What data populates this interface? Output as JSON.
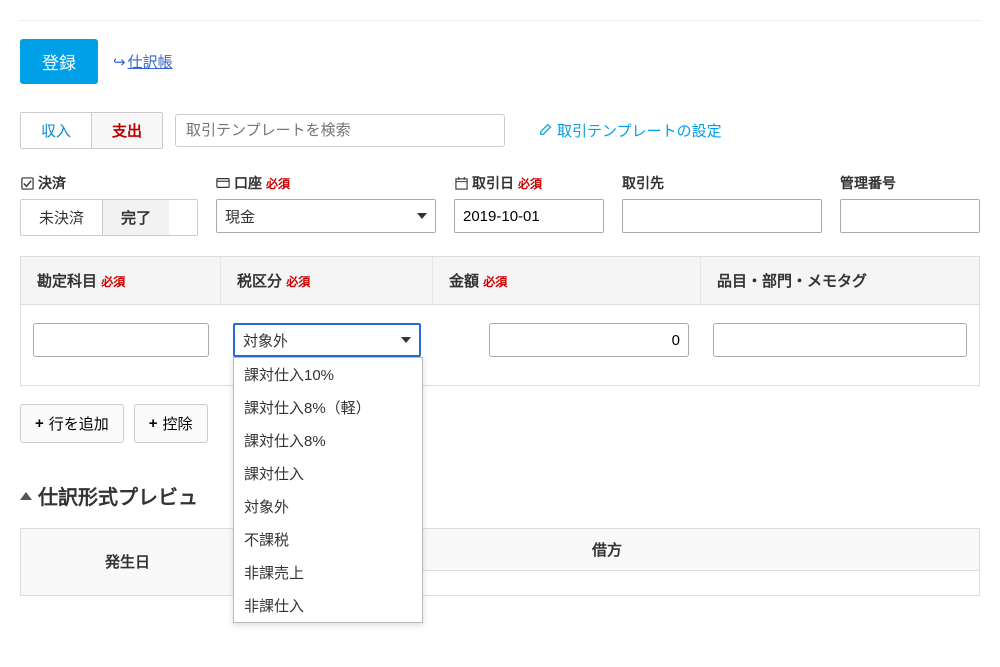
{
  "top": {
    "register_label": "登録",
    "journal_link": "仕訳帳"
  },
  "type_toggle": {
    "income": "収入",
    "expense": "支出"
  },
  "search": {
    "placeholder": "取引テンプレートを検索"
  },
  "template_settings_link": "取引テンプレートの設定",
  "fields": {
    "settlement": {
      "label": "決済",
      "pending": "未決済",
      "done": "完了"
    },
    "account": {
      "label": "口座",
      "value": "現金"
    },
    "date": {
      "label": "取引日",
      "value": "2019-10-01"
    },
    "partner": {
      "label": "取引先"
    },
    "mgmt_no": {
      "label": "管理番号"
    }
  },
  "required_label": "必須",
  "columns": {
    "account": "勘定科目",
    "tax": "税区分",
    "amount": "金額",
    "item": "品目・部門・メモタグ"
  },
  "row": {
    "tax_value": "対象外",
    "amount_value": "0"
  },
  "tax_options": [
    "課対仕入10%",
    "課対仕入8%（軽）",
    "課対仕入8%",
    "課対仕入",
    "対象外",
    "不課税",
    "非課売上",
    "非課仕入"
  ],
  "actions": {
    "add_row": "行を追加",
    "deduction": "控除"
  },
  "preview": {
    "title": "仕訳形式プレビュ",
    "col_date": "発生日",
    "col_debit": "借方"
  }
}
